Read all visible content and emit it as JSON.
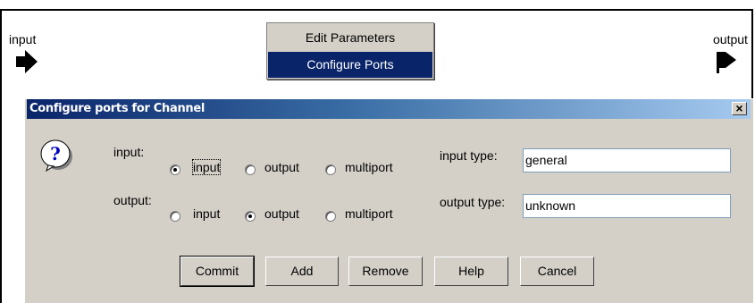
{
  "canvas": {
    "input_port_label": "input",
    "output_port_label": "output"
  },
  "context_menu": {
    "items": [
      {
        "label": "Edit Parameters",
        "selected": false
      },
      {
        "label": "Configure Ports",
        "selected": true
      }
    ]
  },
  "dialog": {
    "title": "Configure ports for Channel",
    "close_label": "×",
    "icon": "question-icon",
    "rows": [
      {
        "port_label": "input:",
        "options": [
          "input",
          "output",
          "multiport"
        ],
        "selected": "input",
        "type_label": "input type:",
        "type_value": "general"
      },
      {
        "port_label": "output:",
        "options": [
          "input",
          "output",
          "multiport"
        ],
        "selected": "output",
        "type_label": "output type:",
        "type_value": "unknown"
      }
    ],
    "buttons": {
      "commit": "Commit",
      "add": "Add",
      "remove": "Remove",
      "help": "Help",
      "cancel": "Cancel"
    }
  },
  "colors": {
    "selection": "#0a246a",
    "dialog_bg": "#d4d0c8",
    "title_gradient_end": "#a6caf0"
  }
}
